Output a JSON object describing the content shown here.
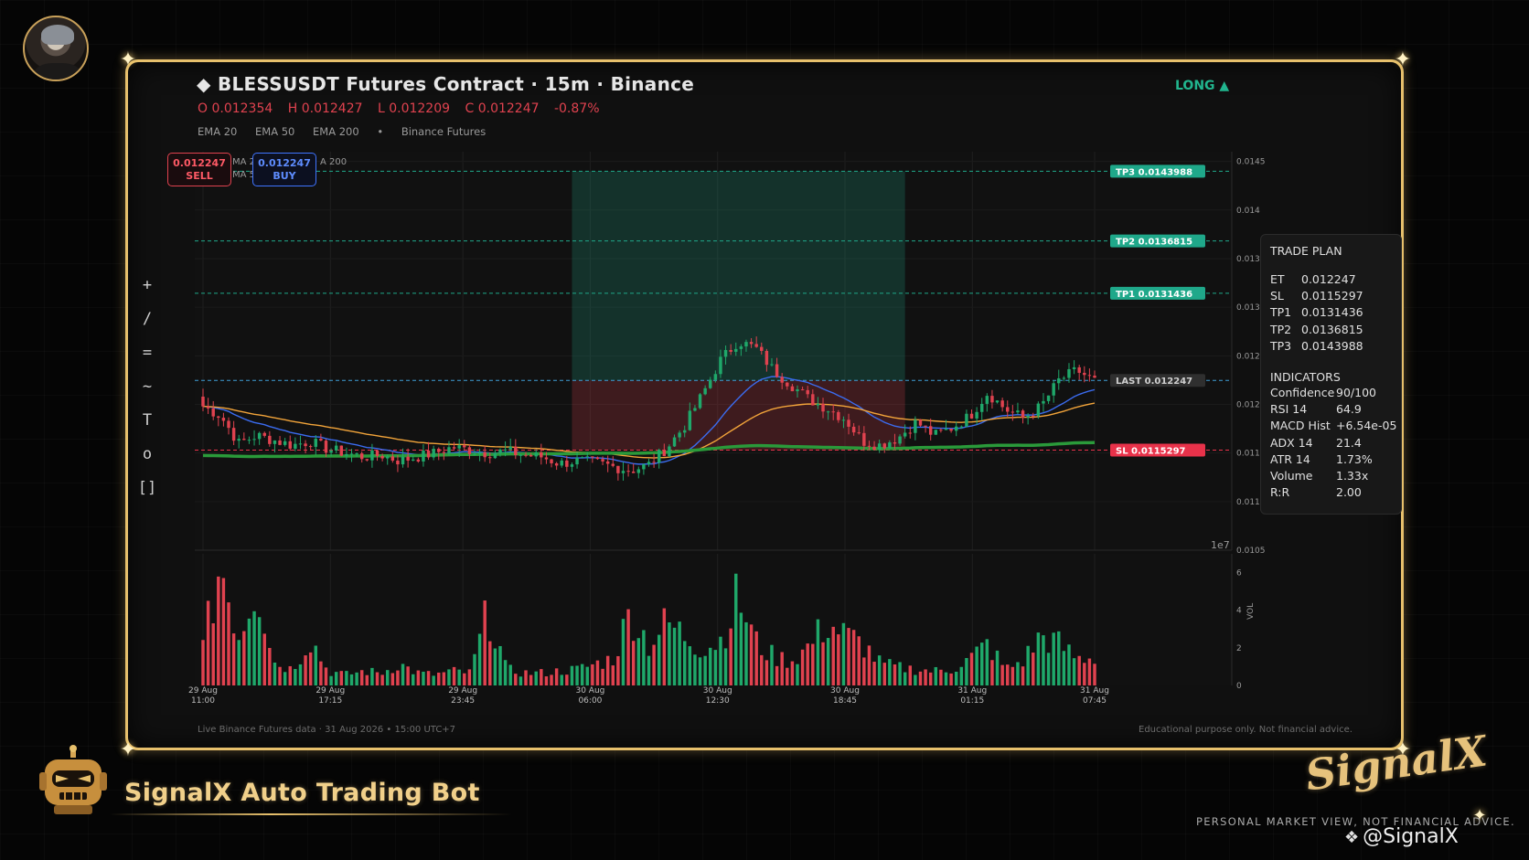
{
  "header": {
    "title": "◆  BLESSUSDT Futures Contract  ·  15m  ·  Binance",
    "ohlc": [
      "O 0.012354",
      "H 0.012427",
      "L 0.012209",
      "C 0.012247",
      "-0.87%"
    ],
    "indicators": [
      "EMA 20",
      "EMA 50",
      "EMA 200",
      "•",
      "Binance Futures"
    ],
    "direction": "LONG ▲"
  },
  "toolbar": [
    "+",
    "/",
    "=",
    "~",
    "T",
    "o",
    "[]"
  ],
  "quote": {
    "sell_price": "0.012247",
    "sell_label": "SELL",
    "buy_price": "0.012247",
    "buy_label": "BUY"
  },
  "legend_fragments": [
    "MA 2",
    "MA 5",
    "A 200"
  ],
  "levels": {
    "tp3": "TP3  0.0143988",
    "tp2": "TP2  0.0136815",
    "tp1": "TP1  0.0131436",
    "last": "LAST  0.012247",
    "sl": "SL  0.0115297"
  },
  "trade_plan": {
    "title": "TRADE PLAN",
    "rows": [
      {
        "k": "ET",
        "v": "0.012247"
      },
      {
        "k": "SL",
        "v": "0.0115297"
      },
      {
        "k": "TP1",
        "v": "0.0131436"
      },
      {
        "k": "TP2",
        "v": "0.0136815"
      },
      {
        "k": "TP3",
        "v": "0.0143988"
      }
    ],
    "indicators_title": "INDICATORS",
    "indicators": [
      {
        "k": "Confidence",
        "v": "90/100"
      },
      {
        "k": "RSI 14",
        "v": "64.9"
      },
      {
        "k": "MACD Hist",
        "v": "+6.54e-05"
      },
      {
        "k": "ADX 14",
        "v": "21.4"
      },
      {
        "k": "ATR 14",
        "v": "1.73%"
      },
      {
        "k": "Volume",
        "v": "1.33x"
      },
      {
        "k": "R:R",
        "v": "2.00"
      }
    ]
  },
  "footer": {
    "left": "Live Binance Futures data  ·  31 Aug 2026 • 15:00 UTC+7",
    "right": "Educational purpose only. Not financial advice."
  },
  "branding": {
    "bot_name": "SignalX Auto Trading Bot",
    "logo": "SignalX",
    "disclaimer": "PERSONAL MARKET VIEW, NOT FINANCIAL ADVICE.",
    "handle": "@SignalX"
  },
  "colors": {
    "up": "#1fa86a",
    "down": "#e0424f",
    "ema20": "#3b6cf0",
    "ema50": "#f2a43a",
    "ema200": "#2a9a3a",
    "tp": "#1fa88a",
    "sl": "#e8324a",
    "gold": "#e7c06c"
  },
  "chart_data": {
    "type": "candlestick",
    "price_axis": {
      "ticks": [
        "0.0145",
        "0.014",
        "0.013",
        "0.013",
        "0.012",
        "0.012",
        "0.011",
        "0.011",
        "0.0105"
      ],
      "ylim": [
        0.0105,
        0.0146
      ],
      "offset_label": "1e7"
    },
    "volume_axis": {
      "ticks": [
        "0",
        "2",
        "4",
        "6"
      ],
      "label": "VOL",
      "ylim": [
        0,
        7
      ]
    },
    "x_ticks": [
      {
        "date": "29 Aug",
        "time": "11:00"
      },
      {
        "date": "29 Aug",
        "time": "17:15"
      },
      {
        "date": "29 Aug",
        "time": "23:45"
      },
      {
        "date": "30 Aug",
        "time": "06:00"
      },
      {
        "date": "30 Aug",
        "time": "12:30"
      },
      {
        "date": "30 Aug",
        "time": "18:45"
      },
      {
        "date": "31 Aug",
        "time": "01:15"
      },
      {
        "date": "31 Aug",
        "time": "07:45"
      }
    ],
    "close_anchors": [
      0.01198,
      0.01188,
      0.0116,
      0.01168,
      0.01163,
      0.01158,
      0.01162,
      0.01154,
      0.0115,
      0.01146,
      0.01148,
      0.01142,
      0.01146,
      0.0115,
      0.01156,
      0.01153,
      0.0115,
      0.01152,
      0.01148,
      0.01146,
      0.01139,
      0.01142,
      0.0114,
      0.01136,
      0.01132,
      0.01138,
      0.01155,
      0.01178,
      0.0121,
      0.01245,
      0.01265,
      0.01258,
      0.01235,
      0.0122,
      0.01205,
      0.01196,
      0.01185,
      0.01162,
      0.01158,
      0.01166,
      0.01182,
      0.01168,
      0.01176,
      0.01188,
      0.01212,
      0.01195,
      0.01186,
      0.01198,
      0.01225,
      0.01235,
      0.01224
    ],
    "volume_anchors": [
      2.1,
      6.9,
      2.8,
      5.9,
      1.3,
      0.9,
      2.7,
      0.8,
      0.6,
      0.8,
      0.7,
      1.2,
      0.7,
      0.6,
      0.8,
      0.7,
      4.2,
      0.9,
      0.7,
      0.7,
      0.8,
      0.9,
      1.2,
      1.5,
      4.2,
      2.3,
      3.5,
      2.8,
      2.1,
      2.5,
      5.0,
      2.4,
      1.6,
      1.4,
      2.2,
      3.5,
      2.8,
      2.3,
      1.2,
      1.0,
      0.9,
      0.8,
      0.9,
      1.5,
      2.3,
      0.9,
      1.4,
      2.8,
      2.3,
      1.5,
      1.6
    ],
    "entry": 0.012247,
    "stop_loss": 0.0115297,
    "take_profits": [
      0.0131436,
      0.0136815,
      0.0143988
    ]
  }
}
